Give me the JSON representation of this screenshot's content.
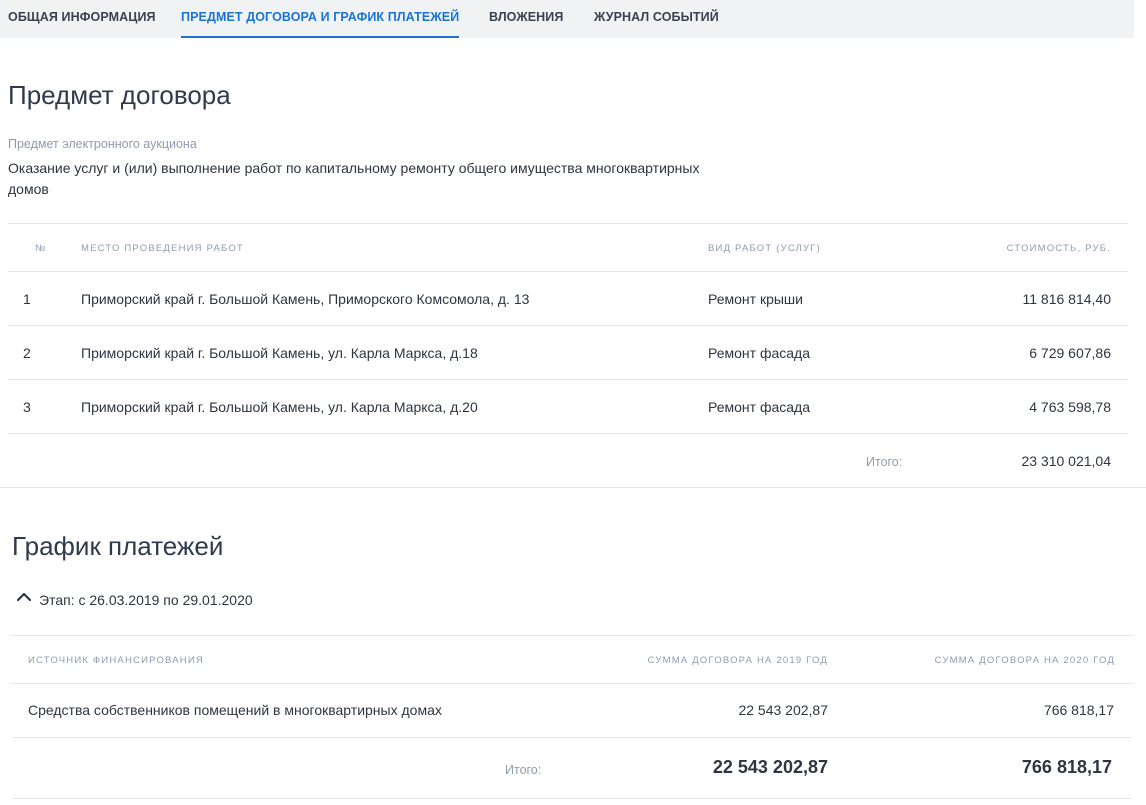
{
  "tabs": [
    {
      "label": "ОБЩАЯ ИНФОРМАЦИЯ"
    },
    {
      "label": "ПРЕДМЕТ ДОГОВОРА И ГРАФИК ПЛАТЕЖЕЙ"
    },
    {
      "label": "ВЛОЖЕНИЯ"
    },
    {
      "label": "ЖУРНАЛ СОБЫТИЙ"
    }
  ],
  "subject": {
    "title": "Предмет договора",
    "caption": "Предмет электронного аукциона",
    "text_line1": "Оказание услуг и (или) выполнение работ по капитальному ремонту общего имущества многоквартирных",
    "text_line2": "домов",
    "columns": [
      "№",
      "МЕСТО ПРОВЕДЕНИЯ РАБОТ",
      "ВИД РАБОТ (УСЛУГ)",
      "СТОИМОСТЬ, РУБ."
    ],
    "rows": [
      {
        "n": "1",
        "place": "Приморский край г. Большой Камень, Приморского Комсомола, д. 13",
        "type": "Ремонт крыши",
        "cost": "11 816 814,40"
      },
      {
        "n": "2",
        "place": "Приморский край г. Большой Камень, ул. Карла Маркса, д.18",
        "type": "Ремонт фасада",
        "cost": "6 729 607,86"
      },
      {
        "n": "3",
        "place": "Приморский край г. Большой Камень, ул. Карла Маркса, д.20",
        "type": "Ремонт фасада",
        "cost": "4 763 598,78"
      }
    ],
    "total_label": "Итого:",
    "total_value": "23 310 021,04"
  },
  "schedule": {
    "title": "График платежей",
    "stage_label": "Этап: с 26.03.2019 по 29.01.2020",
    "columns": [
      "ИСТОЧНИК ФИНАНСИРОВАНИЯ",
      "СУММА ДОГОВОРА НА 2019 ГОД",
      "СУММА ДОГОВОРА НА 2020 ГОД"
    ],
    "rows": [
      {
        "source": "Средства собственников помещений в многоквартирных домах",
        "y2019": "22 543 202,87",
        "y2020": "766 818,17"
      }
    ],
    "total_label": "Итого:",
    "total_2019": "22 543 202,87",
    "total_2020": "766 818,17"
  },
  "colors": {
    "accent": "#1b74d4",
    "muted": "#8f9bb0",
    "divider": "#e3e6ea",
    "tabs_bg": "#f1f2f4"
  },
  "icons": {
    "stage_toggle": "chevron-up-icon"
  }
}
